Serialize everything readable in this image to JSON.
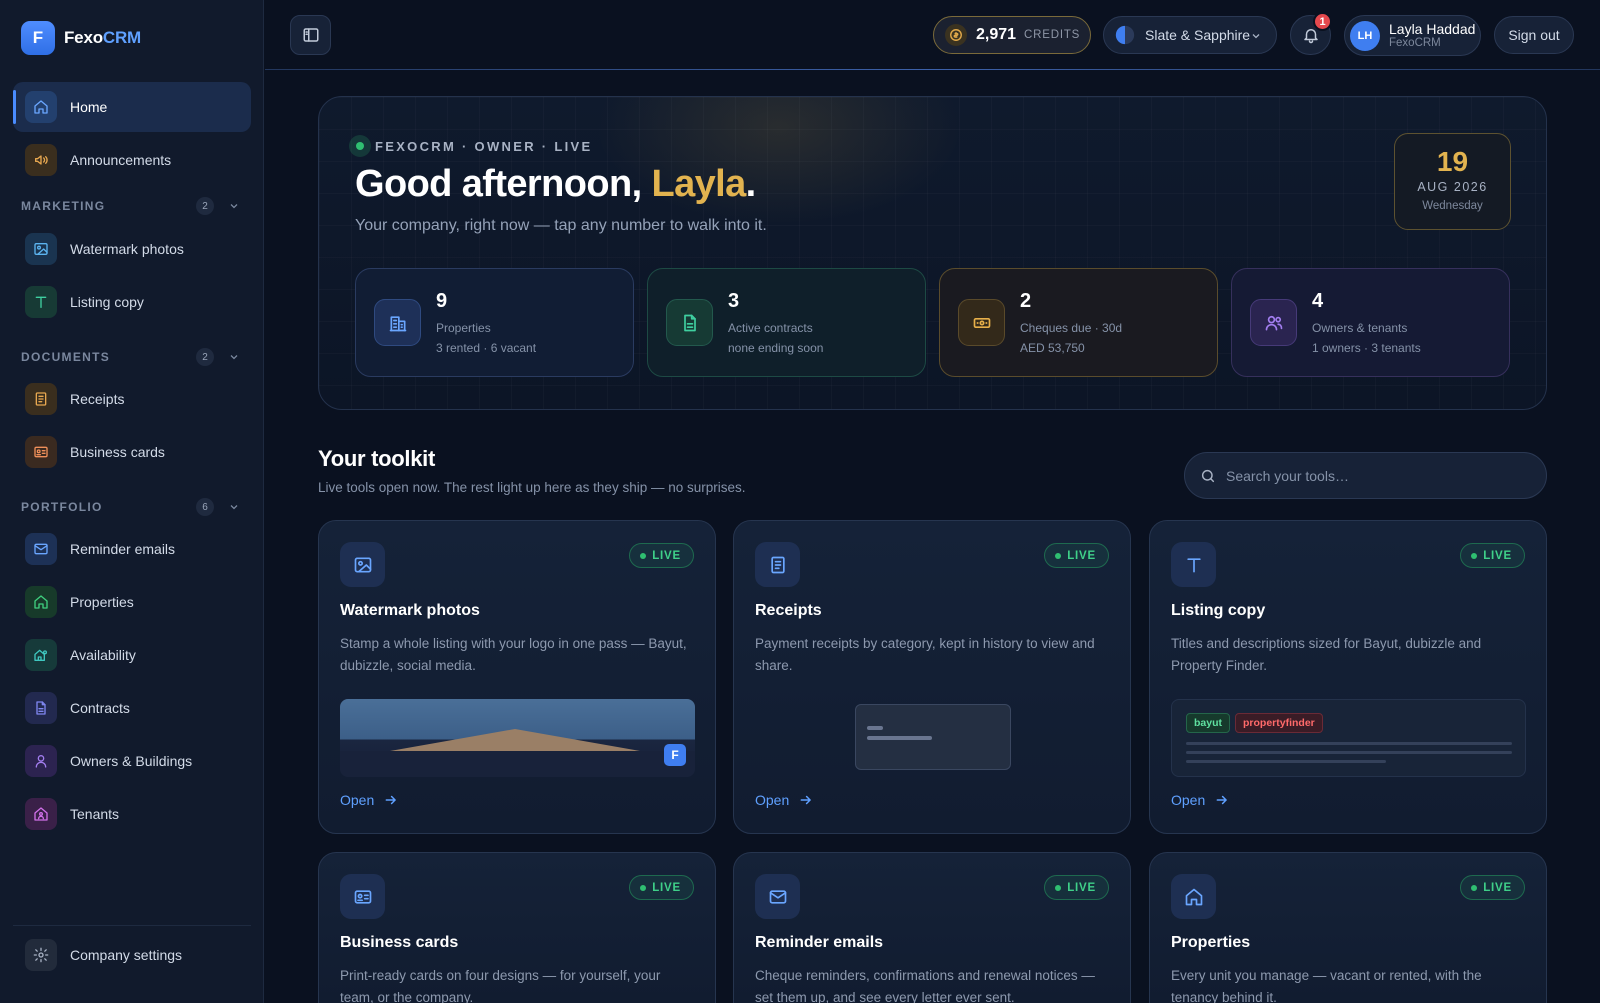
{
  "brand": {
    "logo_letter": "F",
    "name_part1": "Fexo",
    "name_part2": "CRM"
  },
  "sidebar": {
    "home": "Home",
    "announcements": "Announcements",
    "marketing": {
      "title": "MARKETING",
      "count": "2",
      "items": [
        "Watermark photos",
        "Listing copy"
      ]
    },
    "documents": {
      "title": "DOCUMENTS",
      "count": "2",
      "items": [
        "Receipts",
        "Business cards"
      ]
    },
    "portfolio": {
      "title": "PORTFOLIO",
      "count": "6",
      "items": [
        "Reminder emails",
        "Properties",
        "Availability",
        "Contracts",
        "Owners & Buildings",
        "Tenants"
      ]
    },
    "settings": "Company settings"
  },
  "topbar": {
    "credits_value": "2,971",
    "credits_label": "CREDITS",
    "theme": "Slate & Sapphire",
    "notification_count": "1",
    "user_initials": "LH",
    "user_name": "Layla Haddad",
    "user_org": "FexoCRM",
    "sign_out": "Sign out"
  },
  "hero": {
    "eyebrow": "FEXOCRM · OWNER · LIVE",
    "greeting_prefix": "Good afternoon, ",
    "greeting_name": "Layla",
    "greeting_suffix": ".",
    "subtitle": "Your company, right now — tap any number to walk into it.",
    "date": {
      "day": "19",
      "month_year": "AUG 2026",
      "weekday": "Wednesday"
    },
    "stats": [
      {
        "value": "9",
        "label": "Properties",
        "detail": "3 rented · 6 vacant"
      },
      {
        "value": "3",
        "label": "Active contracts",
        "detail": "none ending soon"
      },
      {
        "value": "2",
        "label": "Cheques due · 30d",
        "detail": "AED 53,750"
      },
      {
        "value": "4",
        "label": "Owners & tenants",
        "detail": "1 owners · 3 tenants"
      }
    ]
  },
  "toolkit": {
    "title": "Your toolkit",
    "subtitle": "Live tools open now. The rest light up here as they ship — no surprises.",
    "search_placeholder": "Search your tools…",
    "live_label": "LIVE",
    "open_label": "Open",
    "cards": [
      {
        "title": "Watermark photos",
        "desc": "Stamp a whole listing with your logo in one pass — Bayut, dubizzle, social media.",
        "preview_logo": "F"
      },
      {
        "title": "Receipts",
        "desc": "Payment receipts by category, kept in history to view and share."
      },
      {
        "title": "Listing copy",
        "desc": "Titles and descriptions sized for Bayut, dubizzle and Property Finder.",
        "tags": [
          "bayut",
          "propertyfinder"
        ]
      },
      {
        "title": "Business cards",
        "desc": "Print-ready cards on four designs — for yourself, your team, or the company."
      },
      {
        "title": "Reminder emails",
        "desc": "Cheque reminders, confirmations and renewal notices — set them up, and see every letter ever sent."
      },
      {
        "title": "Properties",
        "desc": "Every unit you manage — vacant or rented, with the tenancy behind it."
      }
    ]
  },
  "colors": {
    "accent": "#4a8cff",
    "gold": "#e2b34f",
    "live_green": "#2fbf71",
    "badge_red": "#e5484d"
  }
}
